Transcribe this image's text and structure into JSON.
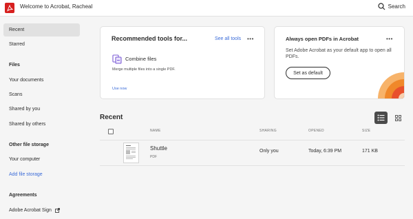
{
  "app": {
    "welcome": "Welcome to Acrobat, Racheal",
    "search_label": "Search"
  },
  "sidebar": {
    "items": [
      {
        "label": "Recent",
        "active": true
      },
      {
        "label": "Starred"
      }
    ],
    "files_heading": "Files",
    "files": [
      {
        "label": "Your documents"
      },
      {
        "label": "Scans"
      },
      {
        "label": "Shared by you"
      },
      {
        "label": "Shared by others"
      }
    ],
    "storage_heading": "Other file storage",
    "storage": [
      {
        "label": "Your computer"
      },
      {
        "label": "Add file storage"
      }
    ],
    "agreements_heading": "Agreements",
    "agreements": [
      {
        "label": "Adobe Acrobat Sign"
      }
    ]
  },
  "tools_card": {
    "title": "Recommended tools for...",
    "see_all": "See all tools",
    "more": "•••",
    "tool_name": "Combine files",
    "tool_desc": "Merge multiple files into a single PDF.",
    "use_now": "Use now"
  },
  "default_card": {
    "title": "Always open PDFs in Acrobat",
    "more": "•••",
    "body": "Set Adobe Acrobat as your default app to open all PDFs.",
    "button": "Set as default"
  },
  "recent": {
    "title": "Recent",
    "columns": {
      "name": "NAME",
      "sharing": "SHARING",
      "opened": "OPENED",
      "size": "SIZE"
    },
    "rows": [
      {
        "name": "Shuttle",
        "type": "PDF",
        "sharing": "Only you",
        "opened": "Today, 6:39 PM",
        "size": "171 KB"
      }
    ]
  },
  "colors": {
    "brand": "#d7201f",
    "link": "#3a6bd8",
    "deco_orange": "#f0882a",
    "deco_peach": "#f7b36a",
    "deco_red": "#e8502c"
  }
}
